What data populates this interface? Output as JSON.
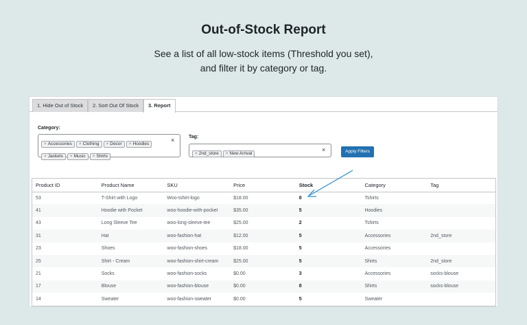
{
  "hero": {
    "title": "Out-of-Stock Report",
    "subtitle": "See a list of all low-stock items (Threshold you set), and filter it by category or tag."
  },
  "tabs": [
    {
      "label": "1. Hide Out of Stock"
    },
    {
      "label": "2. Sort Out Of Stock"
    },
    {
      "label": "3. Report"
    }
  ],
  "filters": {
    "category_label": "Category:",
    "category_chips": [
      "Accessories",
      "Clothing",
      "Decor",
      "Hoodies",
      "Jackets",
      "Music",
      "Shirts"
    ],
    "tag_label": "Tag:",
    "tag_chips": [
      "2nd_store",
      "New Arrival"
    ],
    "chip_remove": "×",
    "clear": "×",
    "apply_label": "Apply Filters"
  },
  "table": {
    "headers": [
      "Product ID",
      "Product Name",
      "SKU",
      "Price",
      "Stock",
      "Category",
      "Tag"
    ],
    "rows": [
      [
        "53",
        "T-Shirt with Logo",
        "Woo-tshirt-logo",
        "$18.00",
        "8",
        "Tshirts",
        ""
      ],
      [
        "41",
        "Hoodie with Pocket",
        "woo-hoodie-with-pocket",
        "$35.00",
        "5",
        "Hoodies",
        ""
      ],
      [
        "43",
        "Long Sleeve Tee",
        "woo-long-sleeve-tee",
        "$25.00",
        "2",
        "Tshirts",
        ""
      ],
      [
        "31",
        "Hat",
        "woo-fashion-hat",
        "$12.00",
        "5",
        "Accessories",
        "2nd_store"
      ],
      [
        "23",
        "Shoes",
        "woo-fashion-shoes",
        "$18.00",
        "5",
        "Accessories",
        ""
      ],
      [
        "25",
        "Shirt - Cream",
        "woo-fashion-shirt-cream",
        "$25.00",
        "5",
        "Shirts",
        "2nd_store"
      ],
      [
        "21",
        "Socks",
        "woo-fashion-socks",
        "$0.00",
        "3",
        "Accessories",
        "socks-blouse"
      ],
      [
        "17",
        "Blouse",
        "woo-fashion-blouse",
        "$0.00",
        "8",
        "Shirts",
        "socks-blouse"
      ],
      [
        "14",
        "Sweater",
        "woo-fashion-sweater",
        "$0.00",
        "5",
        "Sweater",
        ""
      ]
    ]
  },
  "colors": {
    "background": "#dde8e8",
    "accent": "#2271b1",
    "arrow": "#2a8bd0"
  }
}
